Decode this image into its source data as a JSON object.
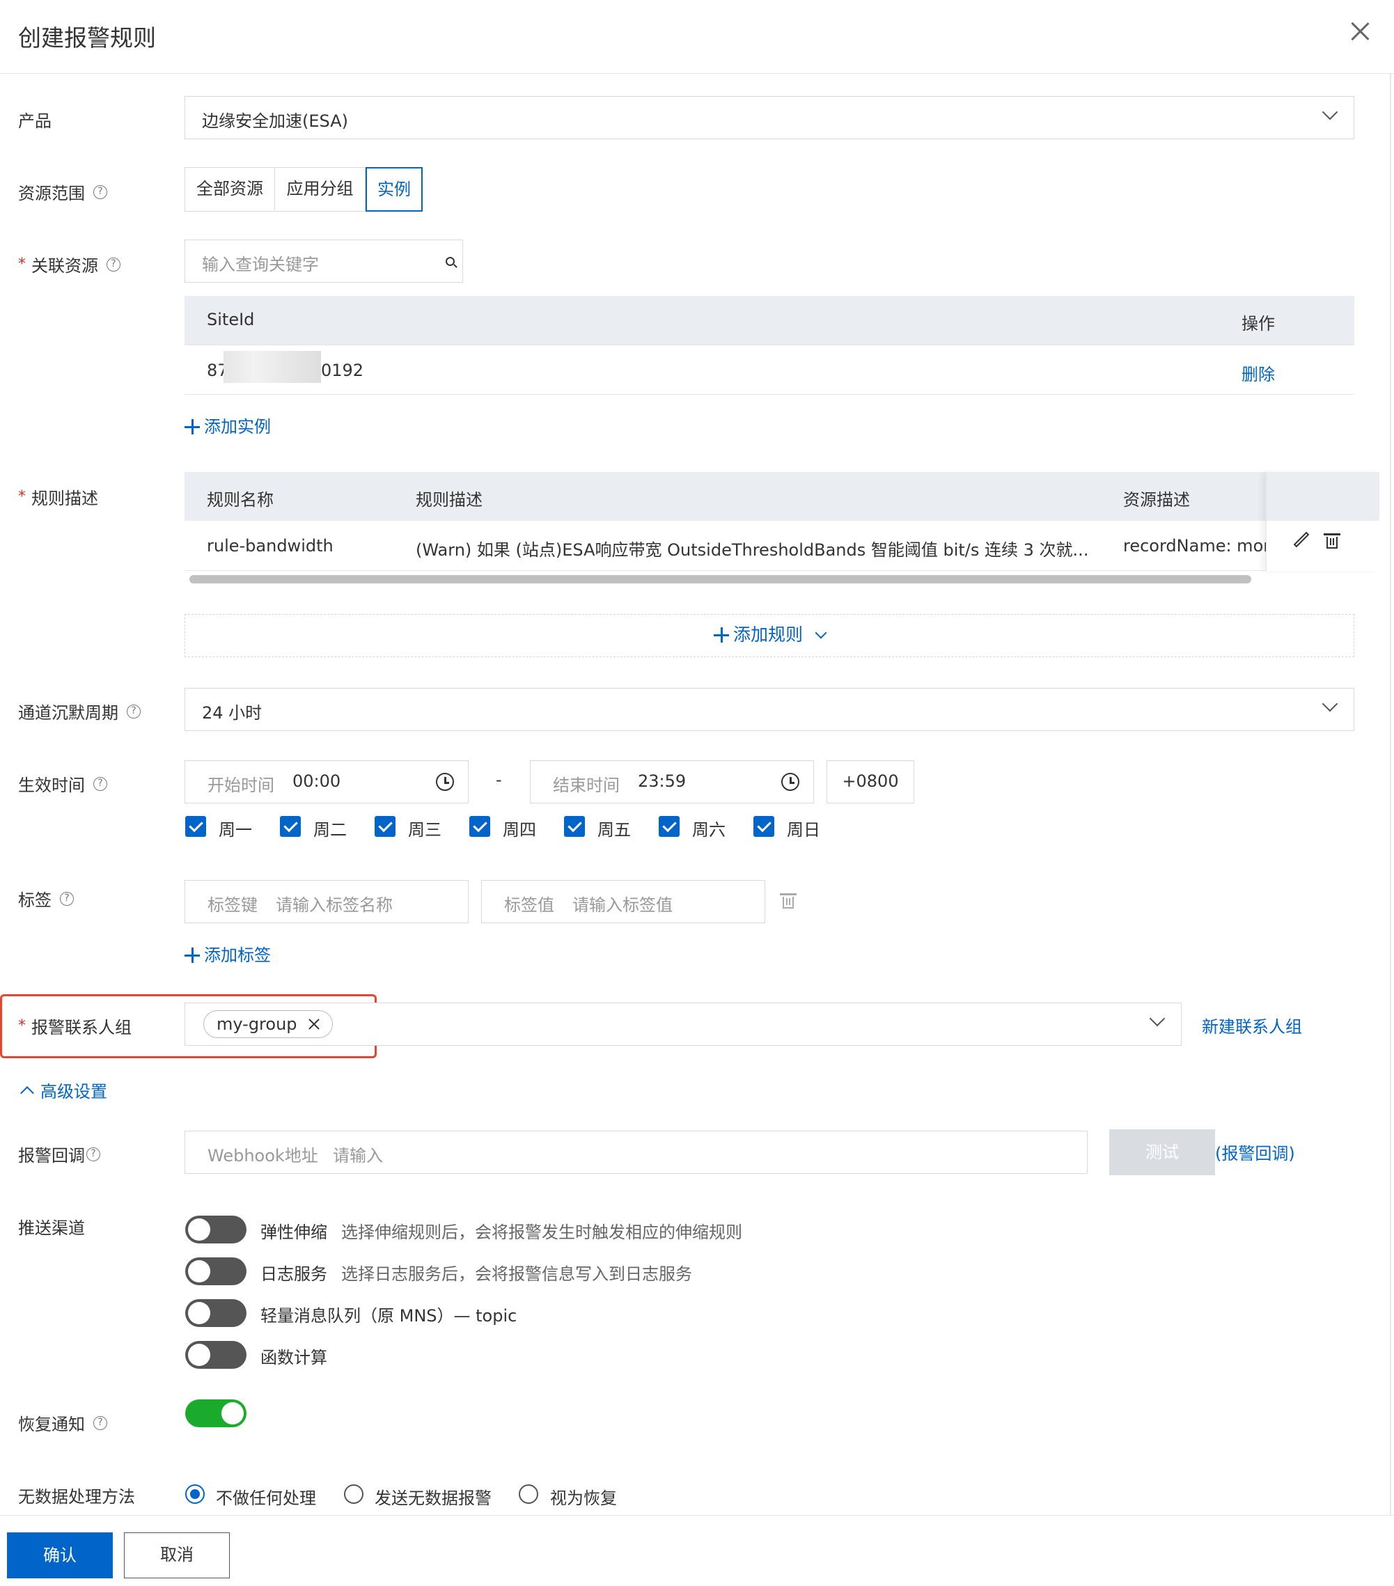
{
  "dialog": {
    "title": "创建报警规则"
  },
  "product": {
    "label": "产品",
    "value": "边缘安全加速(ESA)"
  },
  "scope": {
    "label": "资源范围",
    "options": [
      "全部资源",
      "应用分组",
      "实例"
    ],
    "selected": "实例"
  },
  "resources": {
    "label": "关联资源",
    "search_placeholder": "输入查询关键字",
    "col_site": "SiteId",
    "col_action": "操作",
    "row_site_start": "87",
    "row_site_end": "0192",
    "row_action": "删除",
    "add_label": "添加实例"
  },
  "rules": {
    "label": "规则描述",
    "col_name": "规则名称",
    "col_desc": "规则描述",
    "col_res": "资源描述",
    "row_name": "rule-bandwidth",
    "row_desc": "(Warn) 如果 (站点)ESA响应带宽 OutsideThresholdBands 智能阈值 bit/s 连续 3 次就...",
    "row_res": "recordName: moni",
    "add_label": "添加规则"
  },
  "silence": {
    "label": "通道沉默周期",
    "value": "24 小时"
  },
  "effective": {
    "label": "生效时间",
    "start_label": "开始时间",
    "start_value": "00:00",
    "dash": "-",
    "end_label": "结束时间",
    "end_value": "23:59",
    "timezone": "+0800",
    "days": [
      "周一",
      "周二",
      "周三",
      "周四",
      "周五",
      "周六",
      "周日"
    ]
  },
  "tags": {
    "label": "标签",
    "key_label": "标签键",
    "key_placeholder": "请输入标签名称",
    "value_label": "标签值",
    "value_placeholder": "请输入标签值",
    "add_label": "添加标签"
  },
  "contact": {
    "label": "报警联系人组",
    "chip": "my-group",
    "new_link": "新建联系人组"
  },
  "advanced": {
    "label": "高级设置"
  },
  "callback": {
    "label": "报警回调",
    "webhook_label": "Webhook地址",
    "placeholder": "请输入",
    "test_label": "测试",
    "link": "(报警回调)"
  },
  "channels": {
    "label": "推送渠道",
    "items": [
      {
        "name": "弹性伸缩",
        "desc": "选择伸缩规则后，会将报警发生时触发相应的伸缩规则",
        "on": false
      },
      {
        "name": "日志服务",
        "desc": "选择日志服务后，会将报警信息写入到日志服务",
        "on": false
      },
      {
        "name": "轻量消息队列（原 MNS）— topic",
        "desc": "",
        "on": false
      },
      {
        "name": "函数计算",
        "desc": "",
        "on": false
      }
    ]
  },
  "recovery": {
    "label": "恢复通知",
    "on": true
  },
  "nodata": {
    "label": "无数据处理方法",
    "options": [
      "不做任何处理",
      "发送无数据报警",
      "视为恢复"
    ],
    "selected": "不做任何处理"
  },
  "footer": {
    "confirm": "确认",
    "cancel": "取消"
  },
  "colors": {
    "accent": "#0064c8",
    "highlight_border": "#e8442f",
    "toggle_on": "#1aaa2c"
  }
}
